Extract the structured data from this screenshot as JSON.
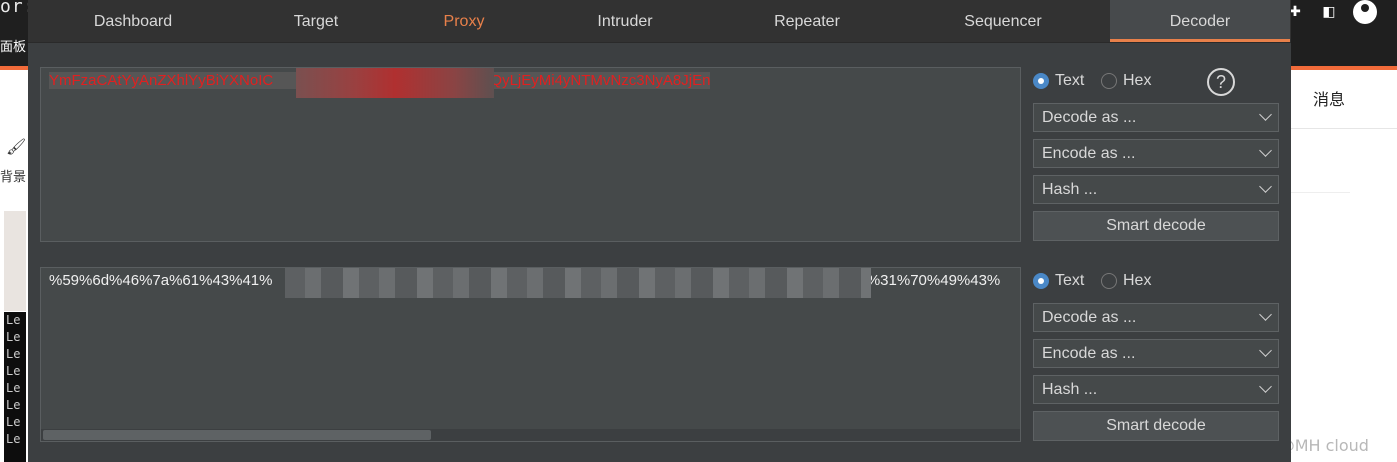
{
  "background_page": {
    "top_text": "or:s",
    "panel_label": "面板",
    "messages_label": "消息",
    "background_label": "背景",
    "terminal_lines": [
      "Le",
      "Le",
      "Le",
      "Le",
      "Le",
      "Le",
      "Le",
      "Le"
    ],
    "watermark": "CSDN @MH cloud"
  },
  "burp": {
    "tabs": [
      {
        "label": "Dashboard"
      },
      {
        "label": "Target"
      },
      {
        "label": "Proxy"
      },
      {
        "label": "Intruder"
      },
      {
        "label": "Repeater"
      },
      {
        "label": "Sequencer"
      },
      {
        "label": "Decoder"
      }
    ],
    "active_tab": "Decoder",
    "panes": [
      {
        "content_visible_start": "YmFzaCAtYyAnZXhlYyBiYXNoIC",
        "content_visible_end": "vLjQyLjEyMi4yNTMvNzc3NyA8JjEn",
        "text_label": "Text",
        "hex_label": "Hex",
        "selected_mode": "Text",
        "decode_label": "Decode as ...",
        "encode_label": "Encode as ...",
        "hash_label": "Hash ...",
        "smart_decode_label": "Smart decode"
      },
      {
        "content_visible_start": "%59%6d%46%7a%61%43%41%",
        "content_visible_end": "3%31%70%49%43%",
        "text_label": "Text",
        "hex_label": "Hex",
        "selected_mode": "Text",
        "decode_label": "Decode as ...",
        "encode_label": "Encode as ...",
        "hash_label": "Hash ...",
        "smart_decode_label": "Smart decode"
      }
    ],
    "help_symbol": "?"
  },
  "colors": {
    "accent": "#e8804a",
    "encoded_text": "#e02020",
    "radio_selected": "#4a88c7"
  }
}
